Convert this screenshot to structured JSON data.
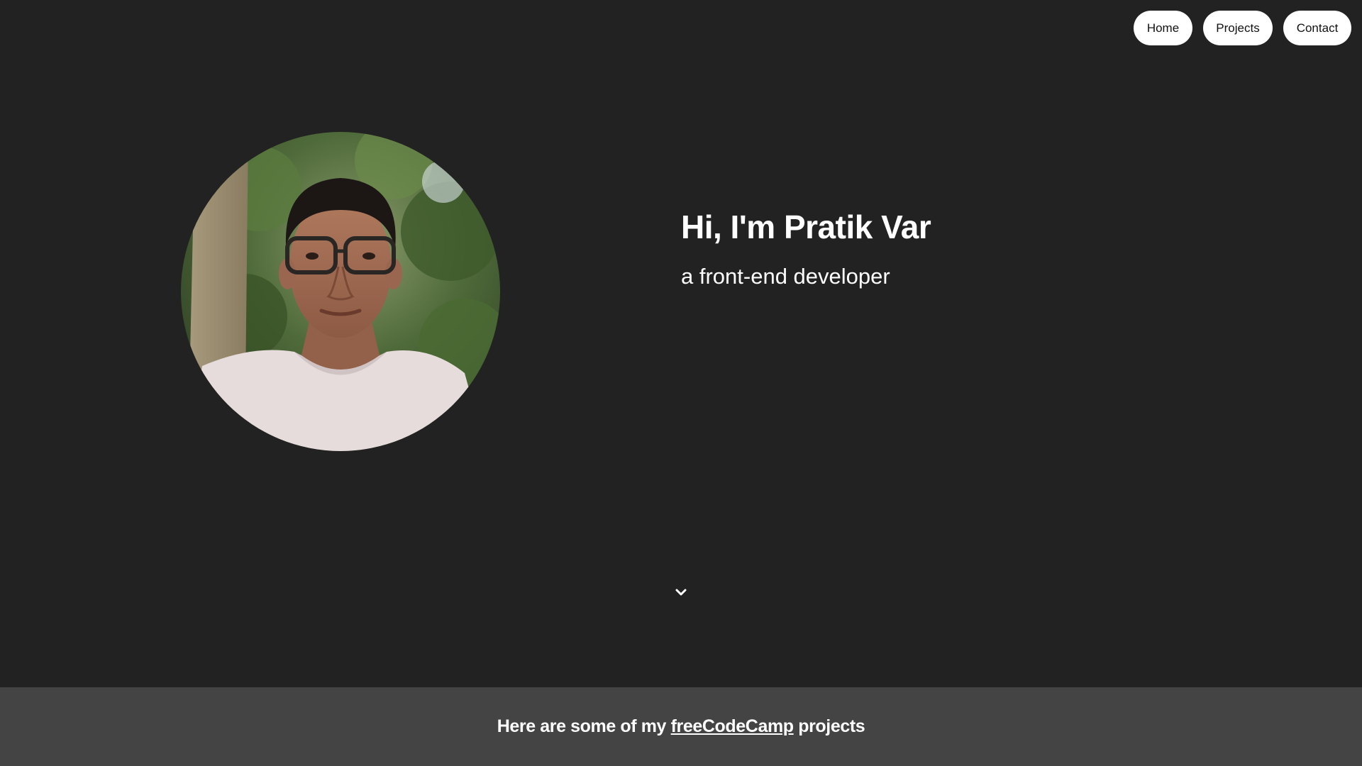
{
  "nav": {
    "items": [
      {
        "label": "Home"
      },
      {
        "label": "Projects"
      },
      {
        "label": "Contact"
      }
    ]
  },
  "hero": {
    "heading": "Hi, I'm Pratik Var",
    "subtitle": "a front-end developer",
    "scroll_icon": "chevron-down-icon"
  },
  "projects": {
    "heading_prefix": "Here are some of my ",
    "link_text": "freeCodeCamp",
    "heading_suffix": " projects"
  },
  "colors": {
    "page_background": "#222222",
    "strip_background": "#444444",
    "text": "#ffffff",
    "nav_button_background": "#ffffff"
  }
}
